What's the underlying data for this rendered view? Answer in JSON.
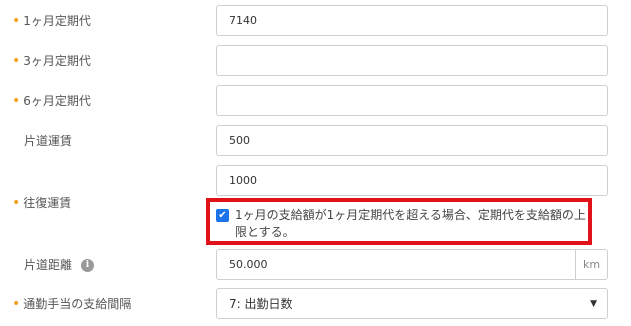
{
  "form": {
    "monthly_pass_1": {
      "label": "1ヶ月定期代",
      "value": "7140",
      "required": true
    },
    "monthly_pass_3": {
      "label": "3ヶ月定期代",
      "value": "",
      "required": true
    },
    "monthly_pass_6": {
      "label": "6ヶ月定期代",
      "value": "",
      "required": true
    },
    "one_way_fare": {
      "label": "片道運賃",
      "value": "500",
      "required": false
    },
    "round_trip_fare": {
      "label": "往復運賃",
      "value": "1000",
      "required": true
    },
    "cap_checkbox": {
      "checked": true,
      "label": "1ヶ月の支給額が1ヶ月定期代を超える場合、定期代を支給額の上限とする。"
    },
    "one_way_distance": {
      "label": "片道距離",
      "value": "50.000",
      "unit": "km",
      "info_icon": "info-icon"
    },
    "payment_interval": {
      "label": "通勤手当の支給間隔",
      "selected": "7: 出勤日数",
      "required": true
    }
  },
  "colors": {
    "required_marker": "#f0a11e",
    "highlight": "#e2121b",
    "checkbox": "#1a73e8"
  }
}
